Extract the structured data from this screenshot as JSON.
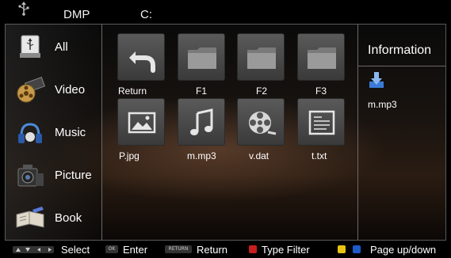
{
  "header": {
    "app_title": "DMP",
    "drive": "C:",
    "usb_icon": "usb-icon"
  },
  "sidebar": {
    "items": [
      {
        "label": "All",
        "icon": "usb-drive-icon"
      },
      {
        "label": "Video",
        "icon": "film-reel-icon"
      },
      {
        "label": "Music",
        "icon": "music-note-icon"
      },
      {
        "label": "Picture",
        "icon": "camera-icon"
      },
      {
        "label": "Book",
        "icon": "book-icon"
      }
    ]
  },
  "files": [
    {
      "label": "Return",
      "icon": "return-arrow-icon"
    },
    {
      "label": "F1",
      "icon": "folder-icon"
    },
    {
      "label": "F2",
      "icon": "folder-icon"
    },
    {
      "label": "F3",
      "icon": "folder-icon"
    },
    {
      "label": "P.jpg",
      "icon": "picture-file-icon"
    },
    {
      "label": "m.mp3",
      "icon": "music-file-icon"
    },
    {
      "label": "v.dat",
      "icon": "video-file-icon"
    },
    {
      "label": "t.txt",
      "icon": "text-file-icon"
    }
  ],
  "info": {
    "title": "Information",
    "file_name": "m.mp3",
    "icon": "download-icon"
  },
  "footer": {
    "select": "Select",
    "enter_key": "OK",
    "enter": "Enter",
    "return_key": "RETURN",
    "return": "Return",
    "type_filter": "Type Filter",
    "page": "Page up/down",
    "colors": {
      "red": "#c81e1e",
      "yellow": "#e8c410",
      "blue": "#1e5ac8"
    }
  }
}
